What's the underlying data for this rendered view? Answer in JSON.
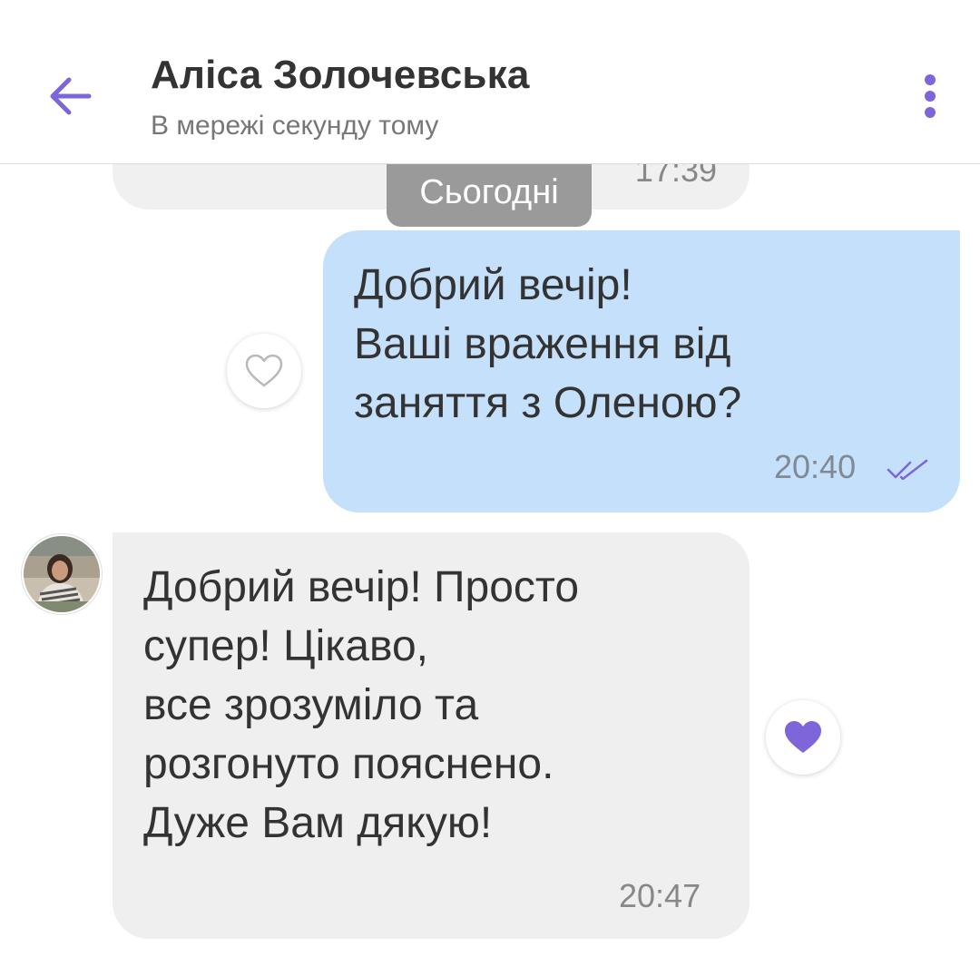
{
  "header": {
    "title": "Аліса Золочевська",
    "subtitle": "В мережі секунду тому",
    "back_icon": "arrow-left-icon",
    "menu_icon": "more-vertical-icon",
    "accent_color": "#7e65d9"
  },
  "chat": {
    "previous_message_time": "17:39",
    "date_separator": "Сьогодні",
    "messages": [
      {
        "direction": "outgoing",
        "text": "Добрий вечір!\nВаші враження від\nзаняття з Оленою?",
        "time": "20:40",
        "status_icon": "double-check-icon",
        "reaction": "heart-outline-icon",
        "bubble_color": "#c5e0fa"
      },
      {
        "direction": "incoming",
        "text": "Добрий вечір! Просто\nсупер! Цікаво,\nвсе зрозуміло та\nрозгонуто пояснено.\nДуже Вам дякую!",
        "time": "20:47",
        "reaction": "heart-filled-icon",
        "bubble_color": "#efefef"
      }
    ]
  }
}
